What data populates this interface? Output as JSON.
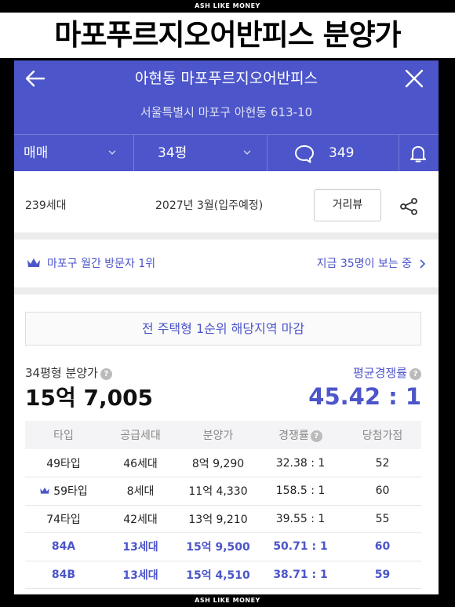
{
  "banner": {
    "top": "ASH LIKE MONEY",
    "bottom": "ASH LIKE MONEY"
  },
  "page_title": "마포푸르지오어반피스 분양가",
  "header": {
    "complex_name": "아현동 마포푸르지오어반피스",
    "address": "서울특별시 마포구 아현동 613-10",
    "filters": {
      "trade_type": "매매",
      "size": "34평",
      "comment_count": "349"
    }
  },
  "info": {
    "households": "239세대",
    "move_in": "2027년 3월(입주예정)",
    "street_view_label": "거리뷰"
  },
  "ranking": {
    "text": "마포구 월간 방문자 1위",
    "viewers": "지금 35명이 보는 중"
  },
  "notice": "전 주택형 1순위 해당지역 마감",
  "price": {
    "label": "34평형 분양가",
    "value": "15억 7,005",
    "competition_label": "평균경쟁률",
    "competition_value": "45.42 : 1"
  },
  "table": {
    "headers": [
      "타입",
      "공급세대",
      "분양가",
      "경쟁률",
      "당첨가점"
    ],
    "rows": [
      {
        "type": "49타입",
        "units": "46세대",
        "price": "8억 9,290",
        "rate": "32.38 : 1",
        "score": "52"
      },
      {
        "type": "59타입",
        "units": "8세대",
        "price": "11억 4,330",
        "rate": "158.5 : 1",
        "score": "60"
      },
      {
        "type": "74타입",
        "units": "42세대",
        "price": "13억 9,210",
        "rate": "39.55 : 1",
        "score": "55"
      },
      {
        "type": "84A",
        "units": "13세대",
        "price": "15억 9,500",
        "rate": "50.71 : 1",
        "score": "60"
      },
      {
        "type": "84B",
        "units": "13세대",
        "price": "15억 4,510",
        "rate": "38.71 : 1",
        "score": "59"
      }
    ]
  },
  "colors": {
    "accent": "#4c55c9",
    "header_bg": "#4c55c9",
    "separator": "#ececec"
  },
  "icons": [
    "back-arrow-icon",
    "close-icon",
    "chevron-down-icon",
    "comment-icon",
    "bell-icon",
    "share-icon",
    "crown-icon",
    "chevron-right-icon",
    "help-icon"
  ]
}
